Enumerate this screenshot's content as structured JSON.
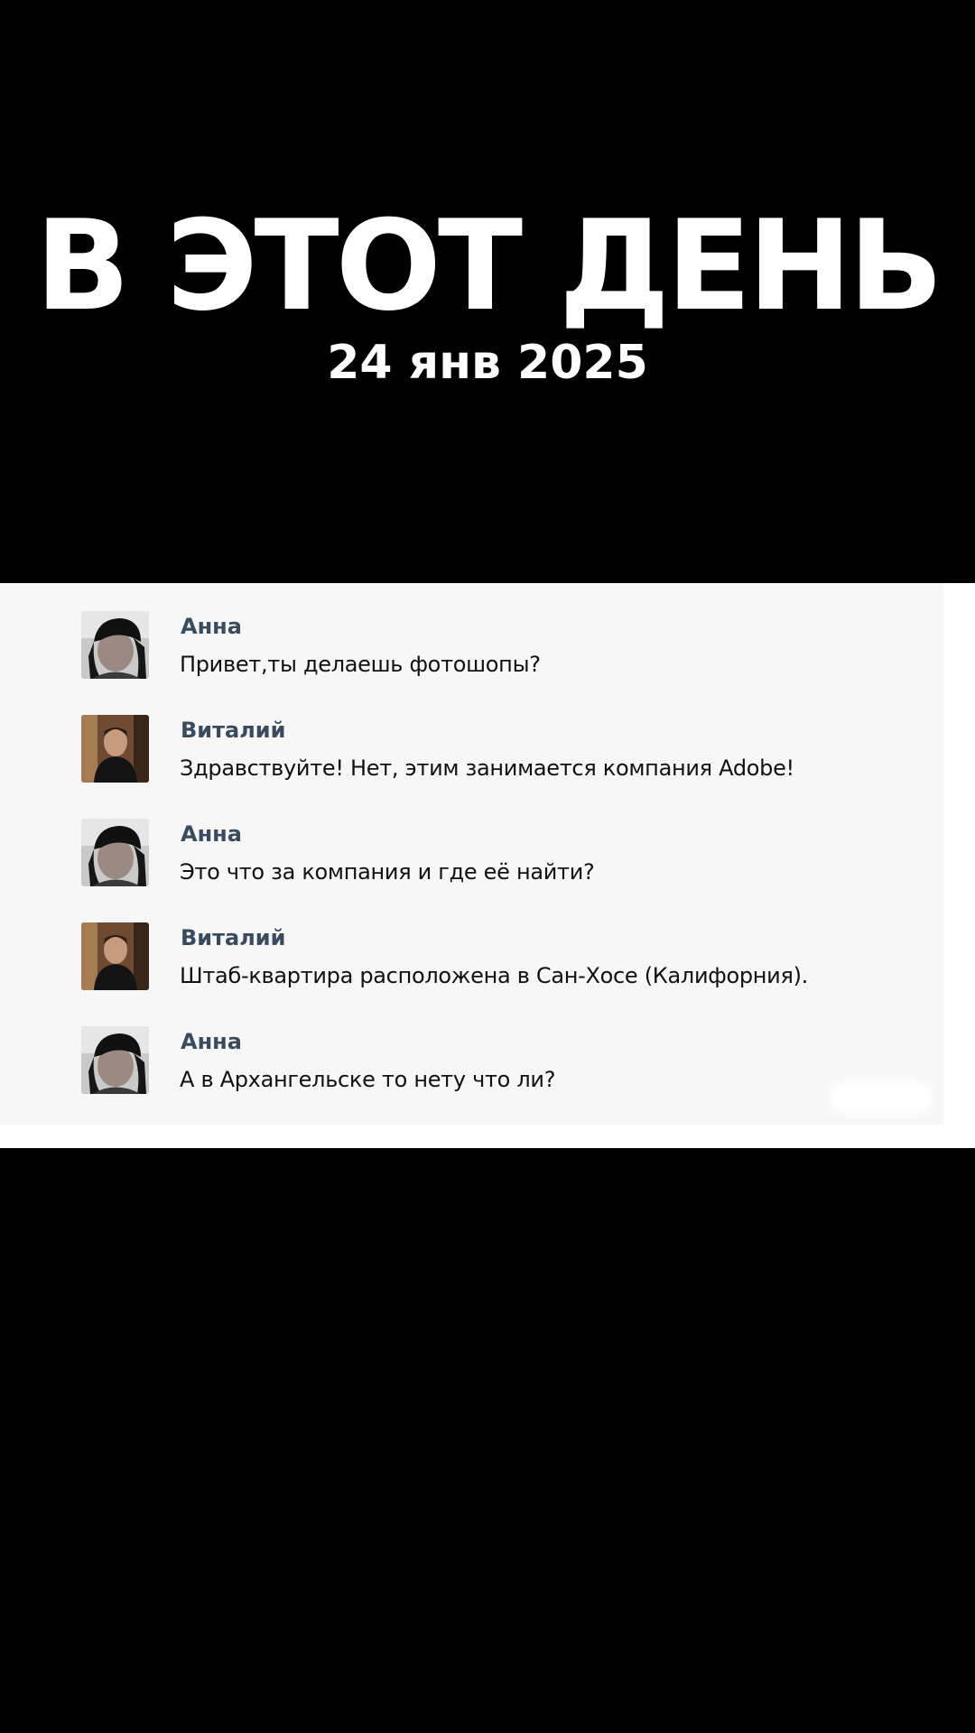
{
  "header": {
    "title": "В ЭТОТ ДЕНЬ",
    "date": "24 янв 2025"
  },
  "chat": {
    "messages": [
      {
        "author": "Анна",
        "text": "Привет,ты делаешь фотошопы?",
        "avatar": "woman-avatar"
      },
      {
        "author": "Виталий",
        "text": "Здравствуйте! Нет, этим занимается компания Adobe!",
        "avatar": "man-avatar"
      },
      {
        "author": "Анна",
        "text": "Это что за компания и где её найти?",
        "avatar": "woman-avatar"
      },
      {
        "author": "Виталий",
        "text": "Штаб-квартира расположена в Сан-Хосе (Калифорния).",
        "avatar": "man-avatar"
      },
      {
        "author": "Анна",
        "text": "А в Архангельске то нету что ли?",
        "avatar": "woman-avatar"
      }
    ]
  },
  "colors": {
    "background": "#000000",
    "heading": "#ffffff",
    "chat_background": "#f7f7f7",
    "author_name": "#3b4b5e",
    "message_text": "#111111"
  }
}
